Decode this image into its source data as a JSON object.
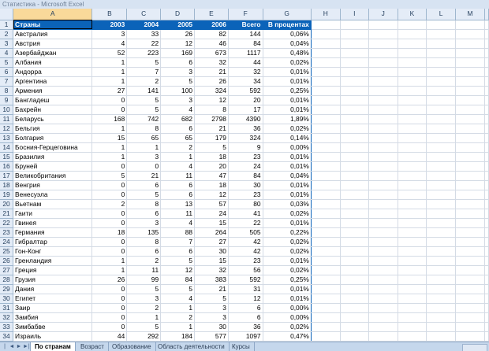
{
  "window": {
    "title": "Статистика - Microsoft Excel"
  },
  "columns": [
    "A",
    "B",
    "C",
    "D",
    "E",
    "F",
    "G",
    "H",
    "I",
    "J",
    "K",
    "L",
    "M"
  ],
  "header_row": {
    "row": 1,
    "cells": [
      "Страны",
      "2003",
      "2004",
      "2005",
      "2006",
      "Всего",
      "В процентах"
    ]
  },
  "rows": [
    {
      "n": 2,
      "cells": [
        "Австралия",
        "3",
        "33",
        "26",
        "82",
        "144",
        "0,06%"
      ]
    },
    {
      "n": 3,
      "cells": [
        "Австрия",
        "4",
        "22",
        "12",
        "46",
        "84",
        "0,04%"
      ]
    },
    {
      "n": 4,
      "cells": [
        "Азербайджан",
        "52",
        "223",
        "169",
        "673",
        "1117",
        "0,48%"
      ]
    },
    {
      "n": 5,
      "cells": [
        "Албания",
        "1",
        "5",
        "6",
        "32",
        "44",
        "0,02%"
      ]
    },
    {
      "n": 6,
      "cells": [
        "Андорра",
        "1",
        "7",
        "3",
        "21",
        "32",
        "0,01%"
      ]
    },
    {
      "n": 7,
      "cells": [
        "Аргентина",
        "1",
        "2",
        "5",
        "26",
        "34",
        "0,01%"
      ]
    },
    {
      "n": 8,
      "cells": [
        "Армения",
        "27",
        "141",
        "100",
        "324",
        "592",
        "0,25%"
      ]
    },
    {
      "n": 9,
      "cells": [
        "Бангладеш",
        "0",
        "5",
        "3",
        "12",
        "20",
        "0,01%"
      ]
    },
    {
      "n": 10,
      "cells": [
        "Бахрейн",
        "0",
        "5",
        "4",
        "8",
        "17",
        "0,01%"
      ]
    },
    {
      "n": 11,
      "cells": [
        "Беларусь",
        "168",
        "742",
        "682",
        "2798",
        "4390",
        "1,89%"
      ]
    },
    {
      "n": 12,
      "cells": [
        "Бельгия",
        "1",
        "8",
        "6",
        "21",
        "36",
        "0,02%"
      ]
    },
    {
      "n": 13,
      "cells": [
        "Болгария",
        "15",
        "65",
        "65",
        "179",
        "324",
        "0,14%"
      ]
    },
    {
      "n": 14,
      "cells": [
        "Босния-Герцеговина",
        "1",
        "1",
        "2",
        "5",
        "9",
        "0,00%"
      ]
    },
    {
      "n": 15,
      "cells": [
        "Бразилия",
        "1",
        "3",
        "1",
        "18",
        "23",
        "0,01%"
      ]
    },
    {
      "n": 16,
      "cells": [
        "Бруней",
        "0",
        "0",
        "4",
        "20",
        "24",
        "0,01%"
      ]
    },
    {
      "n": 17,
      "cells": [
        "Великобритания",
        "5",
        "21",
        "11",
        "47",
        "84",
        "0,04%"
      ]
    },
    {
      "n": 18,
      "cells": [
        "Венгрия",
        "0",
        "6",
        "6",
        "18",
        "30",
        "0,01%"
      ]
    },
    {
      "n": 19,
      "cells": [
        "Венесуэла",
        "0",
        "5",
        "6",
        "12",
        "23",
        "0,01%"
      ]
    },
    {
      "n": 20,
      "cells": [
        "Вьетнам",
        "2",
        "8",
        "13",
        "57",
        "80",
        "0,03%"
      ]
    },
    {
      "n": 21,
      "cells": [
        "Гаити",
        "0",
        "6",
        "11",
        "24",
        "41",
        "0,02%"
      ]
    },
    {
      "n": 22,
      "cells": [
        "Гвинея",
        "0",
        "3",
        "4",
        "15",
        "22",
        "0,01%"
      ]
    },
    {
      "n": 23,
      "cells": [
        "Германия",
        "18",
        "135",
        "88",
        "264",
        "505",
        "0,22%"
      ]
    },
    {
      "n": 24,
      "cells": [
        "Гибралтар",
        "0",
        "8",
        "7",
        "27",
        "42",
        "0,02%"
      ]
    },
    {
      "n": 25,
      "cells": [
        "Гон-Конг",
        "0",
        "6",
        "6",
        "30",
        "42",
        "0,02%"
      ]
    },
    {
      "n": 26,
      "cells": [
        "Гренландия",
        "1",
        "2",
        "5",
        "15",
        "23",
        "0,01%"
      ]
    },
    {
      "n": 27,
      "cells": [
        "Греция",
        "1",
        "11",
        "12",
        "32",
        "56",
        "0,02%"
      ]
    },
    {
      "n": 28,
      "cells": [
        "Грузия",
        "26",
        "99",
        "84",
        "383",
        "592",
        "0,25%"
      ]
    },
    {
      "n": 29,
      "cells": [
        "Дания",
        "0",
        "5",
        "5",
        "21",
        "31",
        "0,01%"
      ]
    },
    {
      "n": 30,
      "cells": [
        "Египет",
        "0",
        "3",
        "4",
        "5",
        "12",
        "0,01%"
      ]
    },
    {
      "n": 31,
      "cells": [
        "Заир",
        "0",
        "2",
        "1",
        "3",
        "6",
        "0,00%"
      ]
    },
    {
      "n": 32,
      "cells": [
        "Замбия",
        "0",
        "1",
        "2",
        "3",
        "6",
        "0,00%"
      ]
    },
    {
      "n": 33,
      "cells": [
        "Зимбабве",
        "0",
        "5",
        "1",
        "30",
        "36",
        "0,02%"
      ]
    },
    {
      "n": 34,
      "cells": [
        "Израиль",
        "44",
        "292",
        "184",
        "577",
        "1097",
        "0,47%"
      ]
    }
  ],
  "sheet_tabs": [
    "По странам",
    "Возраст",
    "Образование",
    "Область деятельности",
    "Курсы"
  ],
  "active_tab": "По странам",
  "nav_icons": [
    "first-sheet-icon",
    "prev-sheet-icon",
    "next-sheet-icon",
    "last-sheet-icon"
  ]
}
